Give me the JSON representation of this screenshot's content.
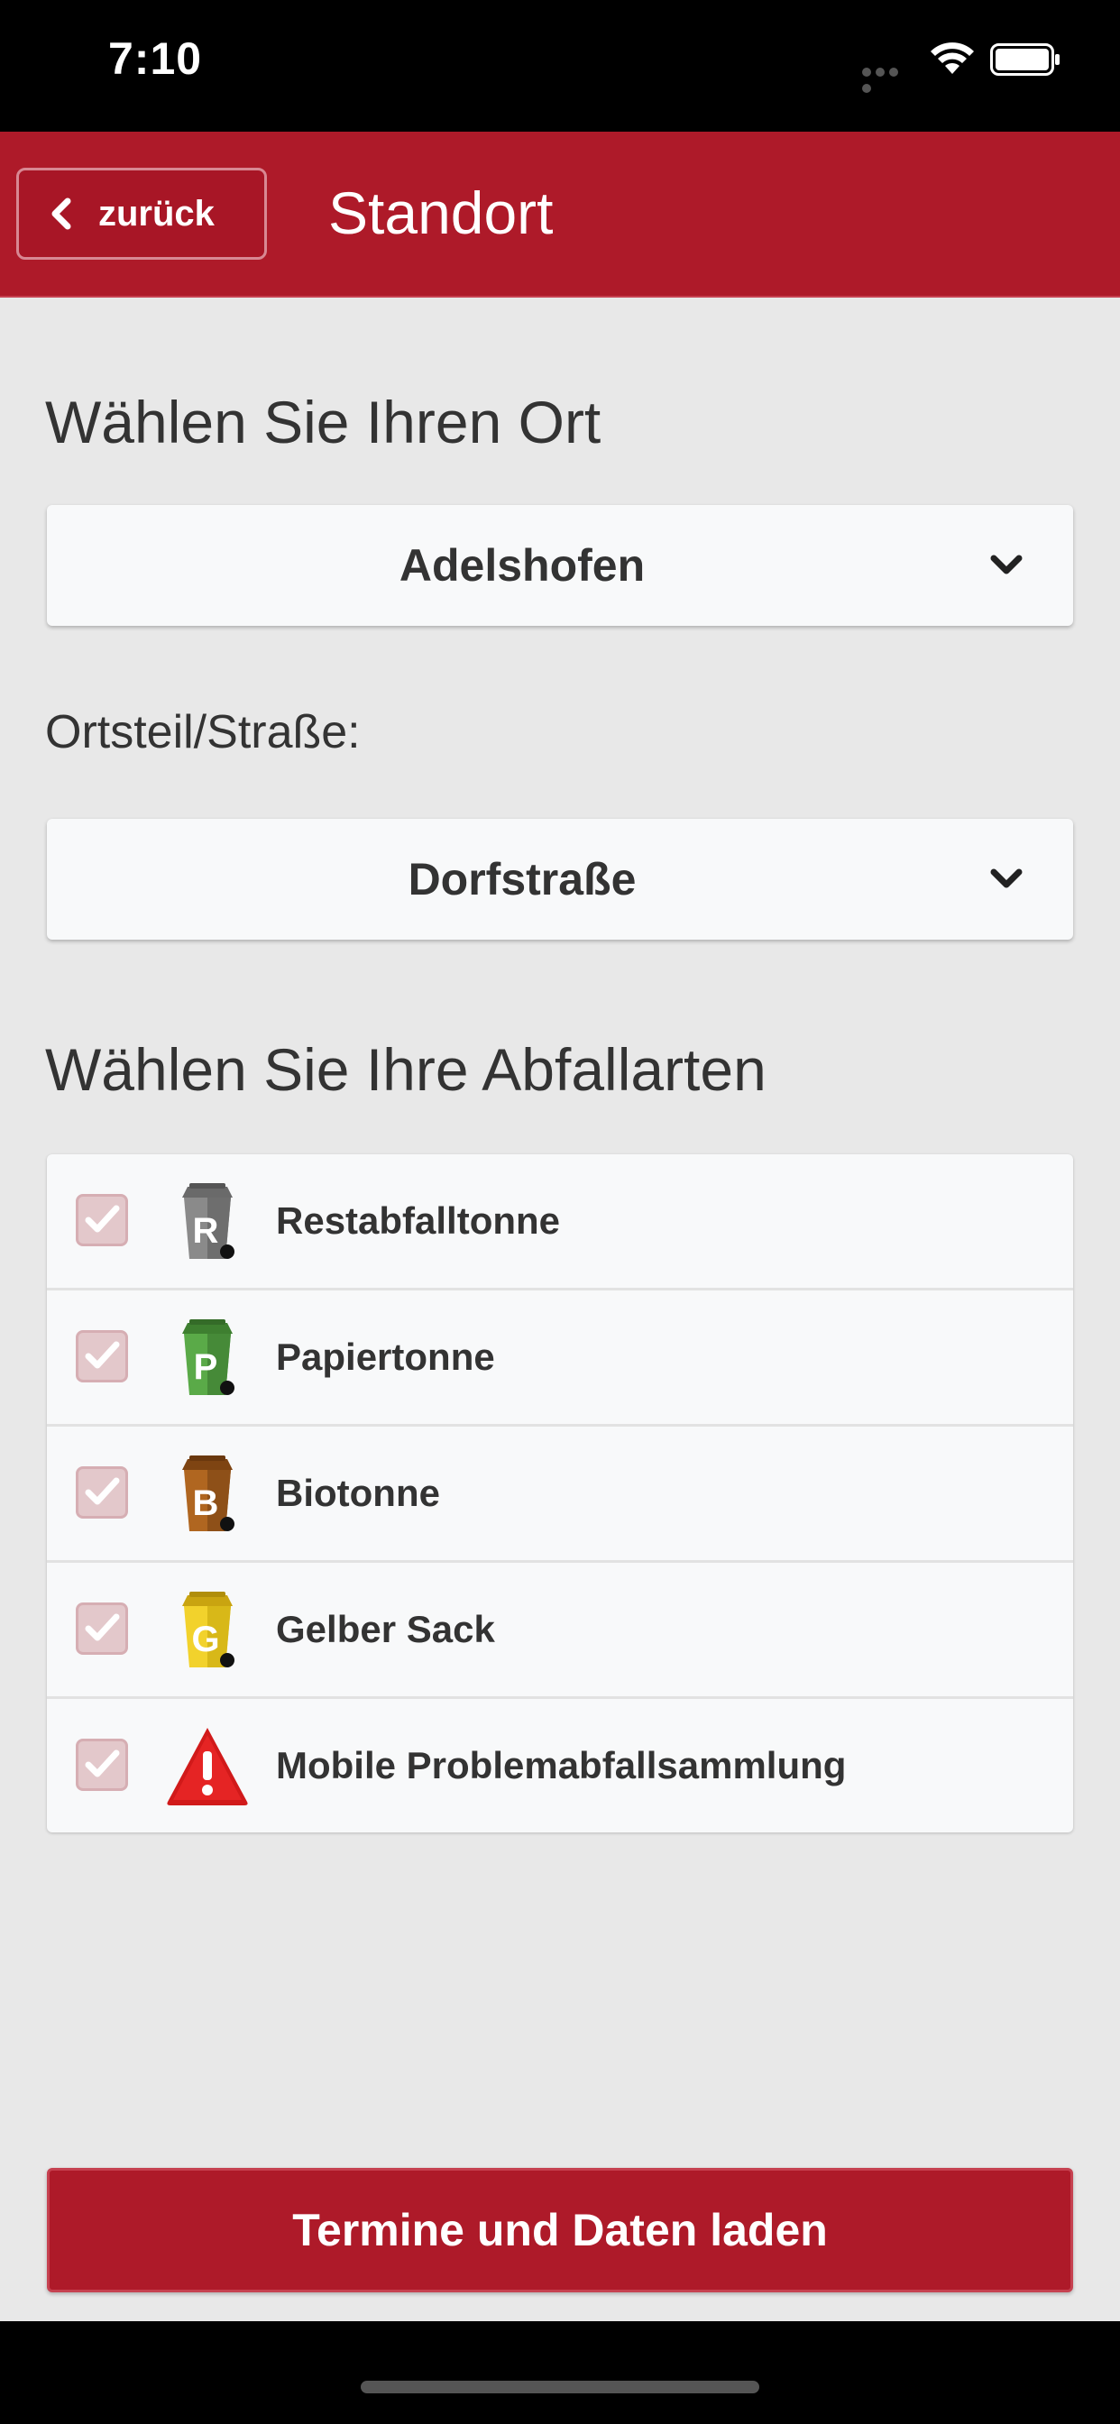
{
  "status_bar": {
    "time": "7:10"
  },
  "header": {
    "back_label": "zurück",
    "title": "Standort"
  },
  "location": {
    "title": "Wählen Sie Ihren Ort",
    "selected": "Adelshofen"
  },
  "street": {
    "label": "Ortsteil/Straße:",
    "selected": "Dorfstraße"
  },
  "waste_types": {
    "title": "Wählen Sie Ihre Abfallarten",
    "items": [
      {
        "label": "Restabfalltonne",
        "letter": "R",
        "color": "#7A7A7A",
        "checked": true
      },
      {
        "label": "Papiertonne",
        "letter": "P",
        "color": "#4E9A3E",
        "checked": true
      },
      {
        "label": "Biotonne",
        "letter": "B",
        "color": "#A0581A",
        "checked": true
      },
      {
        "label": "Gelber Sack",
        "letter": "G",
        "color": "#E8C320",
        "checked": true
      },
      {
        "label": "Mobile Problemabfallsammlung",
        "icon": "warning-icon",
        "color": "#D11A1A",
        "checked": true
      }
    ]
  },
  "actions": {
    "load_label": "Termine und Daten laden"
  },
  "colors": {
    "brand": "#AE1A29",
    "background": "#E8E8E8"
  }
}
